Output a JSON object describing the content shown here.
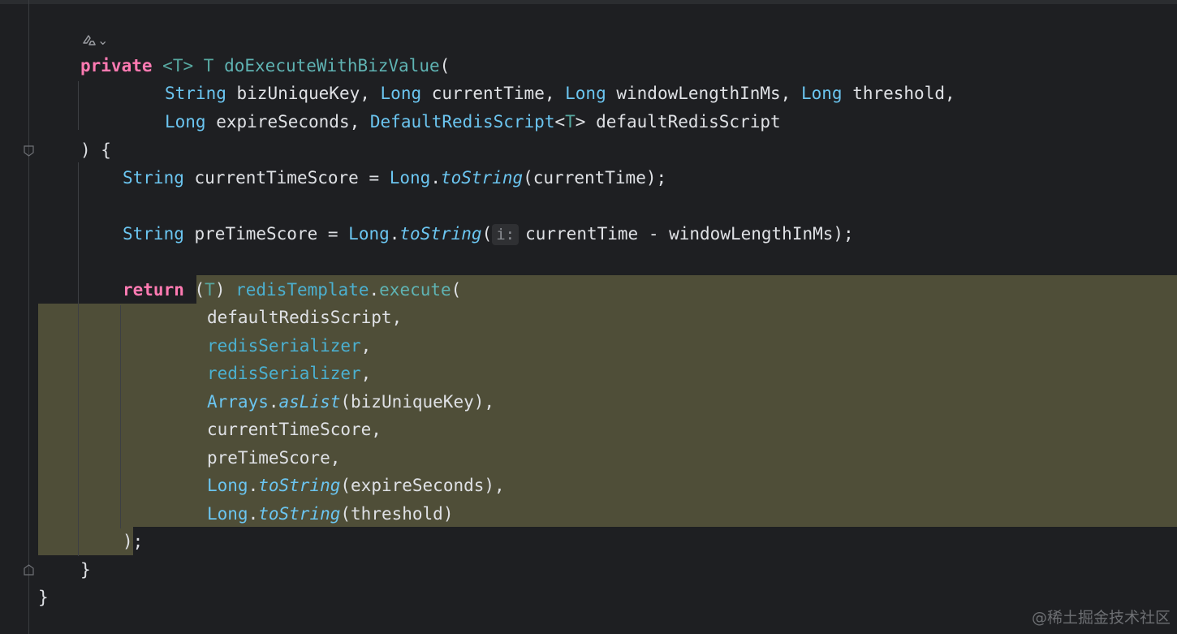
{
  "editor": {
    "language": "Java",
    "code_lines": [
      "private <T> T doExecuteWithBizValue(",
      "String bizUniqueKey, Long currentTime, Long windowLengthInMs, Long threshold,",
      "Long expireSeconds, DefaultRedisScript<T> defaultRedisScript",
      ") {",
      "String currentTimeScore = Long.toString(currentTime);",
      "String preTimeScore = Long.toString(currentTime - windowLengthInMs);",
      "return (T) redisTemplate.execute(",
      "defaultRedisScript,",
      "redisSerializer,",
      "redisSerializer,",
      "Arrays.asList(bizUniqueKey),",
      "currentTimeScore,",
      "preTimeScore,",
      "Long.toString(expireSeconds),",
      "Long.toString(threshold)",
      ");",
      "}",
      "}"
    ],
    "inlay_hint": "i:",
    "annotation_icon": "ai-assistant-icon",
    "annotation_chevron": "⌄"
  },
  "colors": {
    "background": "#1e1f22",
    "keyword": "#ff7ab2",
    "type": "#6bc5f0",
    "type_param": "#57a8a0",
    "field": "#4bb0d0",
    "selection_highlight": "#4f4e38",
    "text": "#dfe1e5"
  },
  "watermark": "@稀土掘金技术社区"
}
